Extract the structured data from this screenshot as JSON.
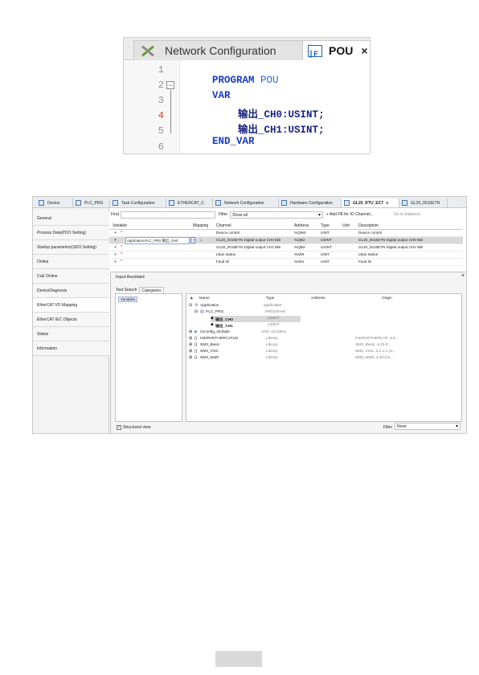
{
  "editor": {
    "tabs": {
      "network_config": "Network Configuration",
      "pou": "POU"
    },
    "close_glyph": "×",
    "line_numbers": [
      "1",
      "2",
      "3",
      "4",
      "5",
      "6"
    ],
    "fold_glyph": "−",
    "lines": {
      "l1_kw": "PROGRAM",
      "l1_name": "POU",
      "l2_kw": "VAR",
      "l3_name": "输出_CH0",
      "l3_colon": ":",
      "l3_type": "USINT",
      "l3_semi": ";",
      "l4_name": "输出_CH1",
      "l4_colon": ":",
      "l4_type": "USINT",
      "l4_semi": ";",
      "l5_kw": "END_VAR"
    }
  },
  "ide": {
    "tabs": [
      "Device",
      "PLC_PRG",
      "Task Configuration",
      "ETHERCAT_C",
      "Network Configuration",
      "Hardware Configuration",
      "GL20_RTU_ECT",
      "GL20_0016ETN"
    ],
    "active_close": "x",
    "sidebar": [
      "General",
      "Process Data(PDO Setting)",
      "Startup parameters(SDO Setting)",
      "Online",
      "CoE Online",
      "DeviceDiagnosis",
      "EtherCAT I/O Mapping",
      "EtherCAT IEC Objects",
      "Status",
      "Information"
    ],
    "find_label": "Find",
    "filter_label": "Filter",
    "filter_value": "Show all",
    "add_fb": "+ Add FB for IO Channel...",
    "goto_instance": "Go to Instance",
    "table_headers": {
      "variable": "Variable",
      "mapping": "Mapping",
      "channel": "Channel",
      "address": "Address",
      "type": "Type",
      "unit": "Unit",
      "description": "Description"
    },
    "rows": [
      {
        "variable": "",
        "channel": "Device control",
        "address": "%QW0",
        "type": "UINT",
        "description": "Device control"
      },
      {
        "variable": "Application.PLC_PRG.输出_CH0",
        "channel": "GL20_0016ETN Digital output CH0 8bit",
        "address": "%QB2",
        "type": "USINT",
        "description": "GL20_0016ETN Digital output CH0 8bit"
      },
      {
        "variable": "",
        "channel": "GL20_0016ETN Digital output CH1 8bit",
        "address": "%QB3",
        "type": "USINT",
        "description": "GL20_0016ETN Digital output CH1 8bit"
      },
      {
        "variable": "",
        "channel": "LBus status",
        "address": "%IW0",
        "type": "UINT",
        "description": "LBus status"
      },
      {
        "variable": "",
        "channel": "Fault ID",
        "address": "%IW1",
        "type": "UINT",
        "description": "Fault ID"
      }
    ],
    "browse_glyph": "...",
    "input_assistant": {
      "title": "Input Assistant",
      "close": "×",
      "tabs": [
        "Text Search",
        "Categories"
      ],
      "category": "Variables",
      "tree_headers": {
        "name": "Name",
        "type": "Type",
        "address": "Address",
        "origin": "Origin"
      },
      "tree": [
        {
          "name": "Application",
          "type": "Application",
          "origin": ""
        },
        {
          "name": "PLC_PRG",
          "type": "PROGRAM",
          "origin": ""
        },
        {
          "name": "输出_CH0",
          "type": "USINT",
          "origin": ""
        },
        {
          "name": "输出_CH1",
          "type": "USINT",
          "origin": ""
        },
        {
          "name": "IoConfig_Globals",
          "type": "VAR_GLOBAL",
          "origin": ""
        },
        {
          "name": "IODRVETHERCATLib",
          "type": "Library",
          "origin": "IODRVETHERCAT, 3.5..."
        },
        {
          "name": "SM3_Basic",
          "type": "Library",
          "origin": "SM3_Basic, 4.10.0..."
        },
        {
          "name": "SM3_CNC",
          "type": "Library",
          "origin": "SM3_CNC, 4.2.1.1 (3..."
        },
        {
          "name": "SM3_Math",
          "type": "Library",
          "origin": "SM3_Math, 4.10.0.0..."
        }
      ],
      "structured_view": "Structured view",
      "filter_label": "Filter",
      "filter_value": "None"
    }
  },
  "colors": {
    "keyword": "#1a3bbf",
    "pou_name": "#2b68c9",
    "line_marker": "#d23a2a",
    "selection": "#d9d9d9"
  }
}
